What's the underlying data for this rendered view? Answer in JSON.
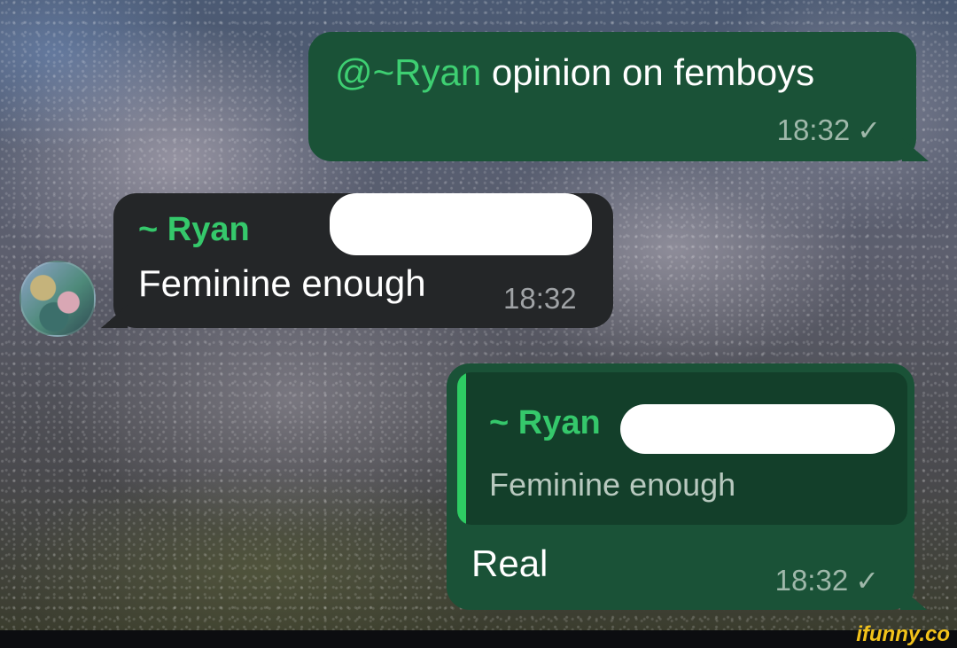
{
  "messages": [
    {
      "mention": "@~Ryan",
      "text": " opinion on femboys",
      "time": "18:32",
      "status_icon": "check-icon"
    },
    {
      "sender": "~ Ryan",
      "text": "Feminine enough",
      "time": "18:32"
    },
    {
      "quote": {
        "sender": "~ Ryan",
        "text": "Feminine enough"
      },
      "text": "Real",
      "time": "18:32",
      "status_icon": "check-icon"
    }
  ],
  "watermark": "ifunny.co",
  "colors": {
    "outgoing_bubble": "#1a5237",
    "incoming_bubble": "#242628",
    "mention": "#3ecf72",
    "sender_name": "#35c86b"
  }
}
